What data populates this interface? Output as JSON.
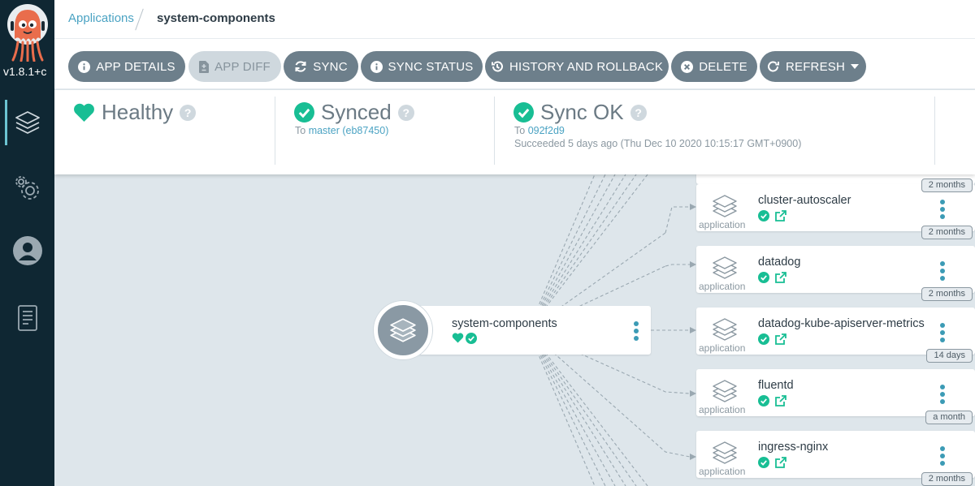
{
  "app": {
    "version": "v1.8.1+c"
  },
  "breadcrumb": {
    "parent": "Applications",
    "current": "system-components"
  },
  "toolbar": {
    "buttons": [
      {
        "label": "APP DETAILS"
      },
      {
        "label": "APP DIFF"
      },
      {
        "label": "SYNC"
      },
      {
        "label": "SYNC STATUS"
      },
      {
        "label": "HISTORY AND ROLLBACK"
      },
      {
        "label": "DELETE"
      },
      {
        "label": "REFRESH"
      }
    ]
  },
  "status": {
    "health": {
      "title": "Healthy"
    },
    "sync": {
      "title": "Synced",
      "to_prefix": "To",
      "target": "master (eb87450)"
    },
    "operation": {
      "title": "Sync OK",
      "to_prefix": "To",
      "revision": "092f2d9",
      "detail": "Succeeded 5 days ago (Thu Dec 10 2020 10:15:17 GMT+0900)"
    }
  },
  "graph": {
    "root": {
      "name": "system-components"
    },
    "apps": [
      {
        "name": "cluster-autoscaler",
        "kind": "application",
        "age": "2 months"
      },
      {
        "name": "datadog",
        "kind": "application",
        "age": "2 months"
      },
      {
        "name": "datadog-kube-apiserver-metrics",
        "kind": "application",
        "age": "14 days"
      },
      {
        "name": "fluentd",
        "kind": "application",
        "age": "a month"
      },
      {
        "name": "ingress-nginx",
        "kind": "application",
        "age": "2 months"
      }
    ],
    "partial_age_top": "2 months"
  },
  "colors": {
    "sidebar": "#0f2733",
    "accent": "#4ba3c3",
    "healthy": "#18be94",
    "button": "#6d7f8b",
    "canvas": "#dee6eb"
  }
}
